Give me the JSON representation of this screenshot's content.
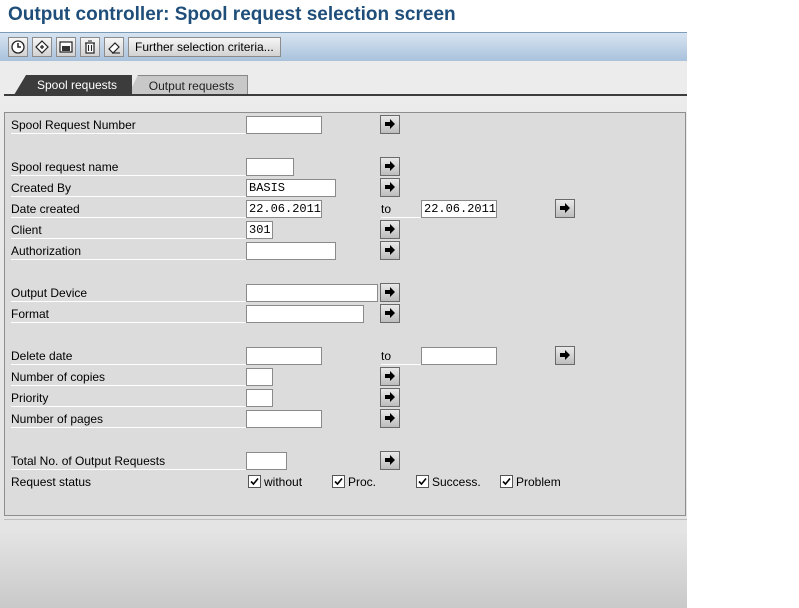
{
  "title": "Output controller: Spool request selection screen",
  "toolbar": {
    "icons": [
      "execute-icon",
      "get-variant-icon",
      "save-variant-icon",
      "delete-icon",
      "eraser-icon"
    ],
    "further_label": "Further selection criteria..."
  },
  "tabs": [
    {
      "label": "Spool requests",
      "active": true
    },
    {
      "label": "Output requests",
      "active": false
    }
  ],
  "fields": {
    "spool_request_number": {
      "label": "Spool Request Number",
      "value": ""
    },
    "spool_request_name": {
      "label": "Spool request name",
      "value": ""
    },
    "created_by": {
      "label": "Created By",
      "value": "BASIS"
    },
    "date_created": {
      "label": "Date created",
      "from": "22.06.2011",
      "to_label": "to",
      "to": "22.06.2011"
    },
    "client": {
      "label": "Client",
      "value": "301"
    },
    "authorization": {
      "label": "Authorization",
      "value": ""
    },
    "output_device": {
      "label": "Output Device",
      "value": ""
    },
    "format": {
      "label": "Format",
      "value": ""
    },
    "delete_date": {
      "label": "Delete date",
      "from": "",
      "to_label": "to",
      "to": ""
    },
    "number_of_copies": {
      "label": "Number of copies",
      "value": ""
    },
    "priority": {
      "label": "Priority",
      "value": ""
    },
    "number_of_pages": {
      "label": "Number of pages",
      "value": ""
    },
    "total_output_requests": {
      "label": "Total No. of Output Requests",
      "value": ""
    }
  },
  "request_status": {
    "label": "Request status",
    "options": [
      {
        "label": "without",
        "checked": true
      },
      {
        "label": "Proc.",
        "checked": true
      },
      {
        "label": "Success.",
        "checked": true
      },
      {
        "label": "Problem",
        "checked": true
      }
    ]
  },
  "colors": {
    "title": "#1f4e7a",
    "toolbar": "#a9c2dc",
    "active_tab": "#3c3c3c"
  }
}
